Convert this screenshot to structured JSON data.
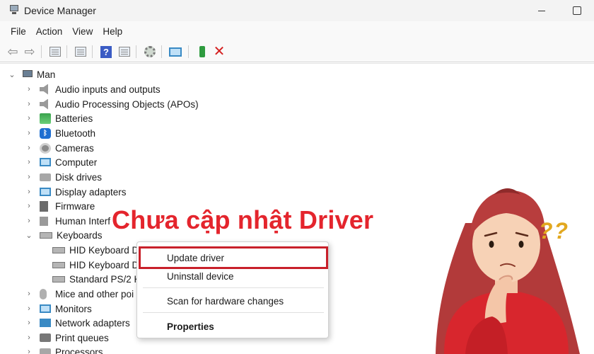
{
  "window": {
    "title": "Device Manager",
    "icon": "device-manager-icon"
  },
  "menubar": [
    "File",
    "Action",
    "View",
    "Help"
  ],
  "toolbar": {
    "icons": [
      "back-arrow-icon",
      "forward-arrow-icon",
      "properties-sheet-icon",
      "driver-details-icon",
      "help-icon",
      "show-hidden-icon",
      "scan-hardware-icon",
      "monitor-icon",
      "update-driver-icon",
      "uninstall-red-x-icon"
    ]
  },
  "tree": {
    "root": "Man",
    "categories": [
      "Audio inputs and outputs",
      "Audio Processing Objects (APOs)",
      "Batteries",
      "Bluetooth",
      "Cameras",
      "Computer",
      "Disk drives",
      "Display adapters",
      "Firmware",
      "Human Interf",
      "Keyboards"
    ],
    "keyboard_children": [
      "HID Keyboard D",
      "HID Keyboard D",
      "Standard PS/2 K"
    ],
    "after": [
      "Mice and other poi",
      "Monitors",
      "Network adapters",
      "Print queues",
      "Processors"
    ]
  },
  "context_menu": {
    "items": [
      "Update driver",
      "Uninstall device",
      "Scan for hardware changes",
      "Properties"
    ]
  },
  "overlay": {
    "headline": "Chưa cập nhật Driver",
    "question_marks": "??",
    "headline_color": "#e4252d",
    "highlight_color": "#c8202a"
  }
}
